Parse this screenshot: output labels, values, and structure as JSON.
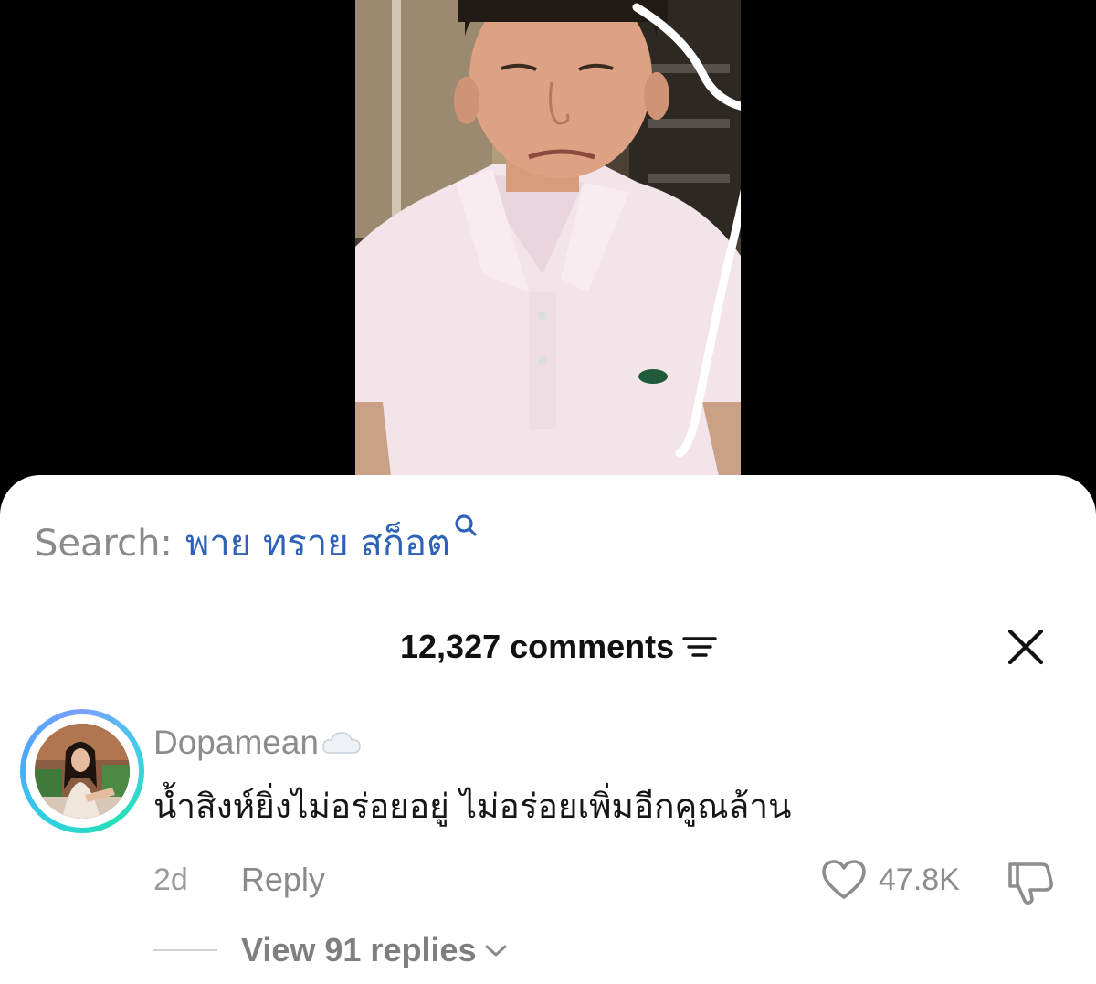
{
  "colors": {
    "background": "#000000",
    "sheet": "#ffffff",
    "search_term": "#2e62b8",
    "muted_text": "#8d8d8d",
    "primary_text": "#161616"
  },
  "video": {
    "description_icons": [
      "person-in-pink-polo-video-frame",
      "white-drawn-line-overlay"
    ]
  },
  "search": {
    "prefix": "Search:",
    "term": "พาย ทราย สก็อต",
    "icon": "search-icon"
  },
  "comments": {
    "count_label": "12,327 comments",
    "filter_icon": "sort-filter-icon",
    "close_icon": "close-icon"
  },
  "comment": {
    "username": "Dopamean",
    "username_badge_icon": "cloud-icon",
    "text": "น้ำสิงห์ยิ่งไม่อร่อยอยู่ ไม่อร่อยเพิ่มอีกคูณล้าน",
    "timestamp": "2d",
    "reply_label": "Reply",
    "like_count": "47.8K",
    "like_icon": "heart-icon",
    "dislike_icon": "thumbs-down-icon",
    "view_replies_label": "View 91 replies",
    "avatar_ring_colors": [
      "#7a9fff",
      "#3fcfe6",
      "#25e0b5"
    ]
  }
}
